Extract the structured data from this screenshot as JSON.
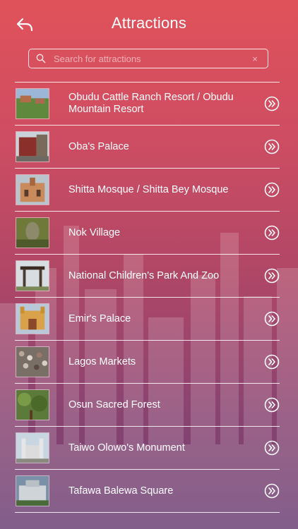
{
  "header": {
    "title": "Attractions",
    "back_icon": "back-arrow-icon"
  },
  "search": {
    "placeholder": "Search for attractions",
    "value": "",
    "search_icon": "search-icon",
    "clear_label": "×"
  },
  "attractions": [
    {
      "label": "Obudu Cattle Ranch Resort / Obudu Mountain Resort"
    },
    {
      "label": "Oba's Palace"
    },
    {
      "label": "Shitta Mosque / Shitta Bey Mosque"
    },
    {
      "label": "Nok Village"
    },
    {
      "label": "National Children's Park And Zoo"
    },
    {
      "label": "Emir's Palace"
    },
    {
      "label": "Lagos Markets"
    },
    {
      "label": "Osun Sacred Forest"
    },
    {
      "label": "Taiwo Olowo's Monument"
    },
    {
      "label": "Tafawa Balewa Square"
    }
  ],
  "colors": {
    "gradient_top": "#e0525a",
    "gradient_bottom": "#6a3f75",
    "foreground": "#ffffff"
  }
}
